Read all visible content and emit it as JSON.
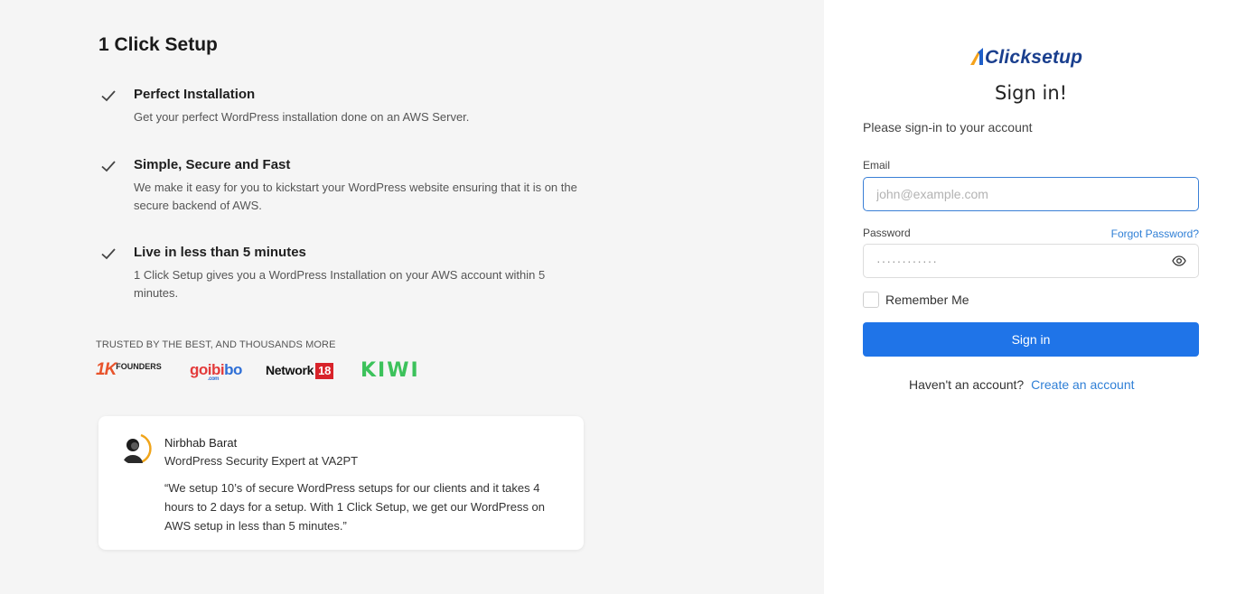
{
  "left": {
    "title": "1 Click Setup",
    "features": [
      {
        "title": "Perfect Installation",
        "description": "Get your perfect WordPress installation done on an AWS Server."
      },
      {
        "title": "Simple, Secure and Fast",
        "description": "We make it easy for you to kickstart your WordPress website ensuring that it is on the secure backend of AWS."
      },
      {
        "title": "Live in less than 5 minutes",
        "description": "1 Click Setup gives you a WordPress Installation on your AWS account within 5 minutes."
      }
    ],
    "trusted_label": "TRUSTED BY THE BEST, AND THOUSANDS MORE",
    "logos": {
      "onek_big": "1K",
      "onek_small": "FOUNDERS",
      "goibibo_a": "goibi",
      "goibibo_b": "bo",
      "goibibo_com": ".com",
      "network": "Network",
      "network_num": "18",
      "kiwi": "KIWI"
    },
    "testimonial": {
      "name": "Nirbhab Barat",
      "role": "WordPress Security Expert at VA2PT",
      "quote": "“We setup 10’s of secure WordPress setups for our clients and it takes 4 hours to 2 days for a setup. With 1 Click Setup, we get our WordPress on AWS setup in less than 5 minutes.”"
    }
  },
  "right": {
    "brand": "Clicksetup",
    "title": "Sign in!",
    "subtitle": "Please sign-in to your account",
    "email": {
      "label": "Email",
      "placeholder": "john@example.com",
      "value": ""
    },
    "password": {
      "label": "Password",
      "value": "············"
    },
    "forgot_label": "Forgot Password?",
    "remember_label": "Remember Me",
    "remember_checked": false,
    "submit_label": "Sign in",
    "no_account_text": "Haven't an account?",
    "create_account_label": "Create an account"
  },
  "colors": {
    "accent": "#1f74e8",
    "link": "#2f7fd6",
    "brand": "#1a3f8e",
    "left_bg": "#f5f5f5"
  },
  "icons": {
    "feature_check": "check-icon",
    "password_toggle": "eye-icon",
    "brand_mark": "clicksetup-logo-icon"
  }
}
